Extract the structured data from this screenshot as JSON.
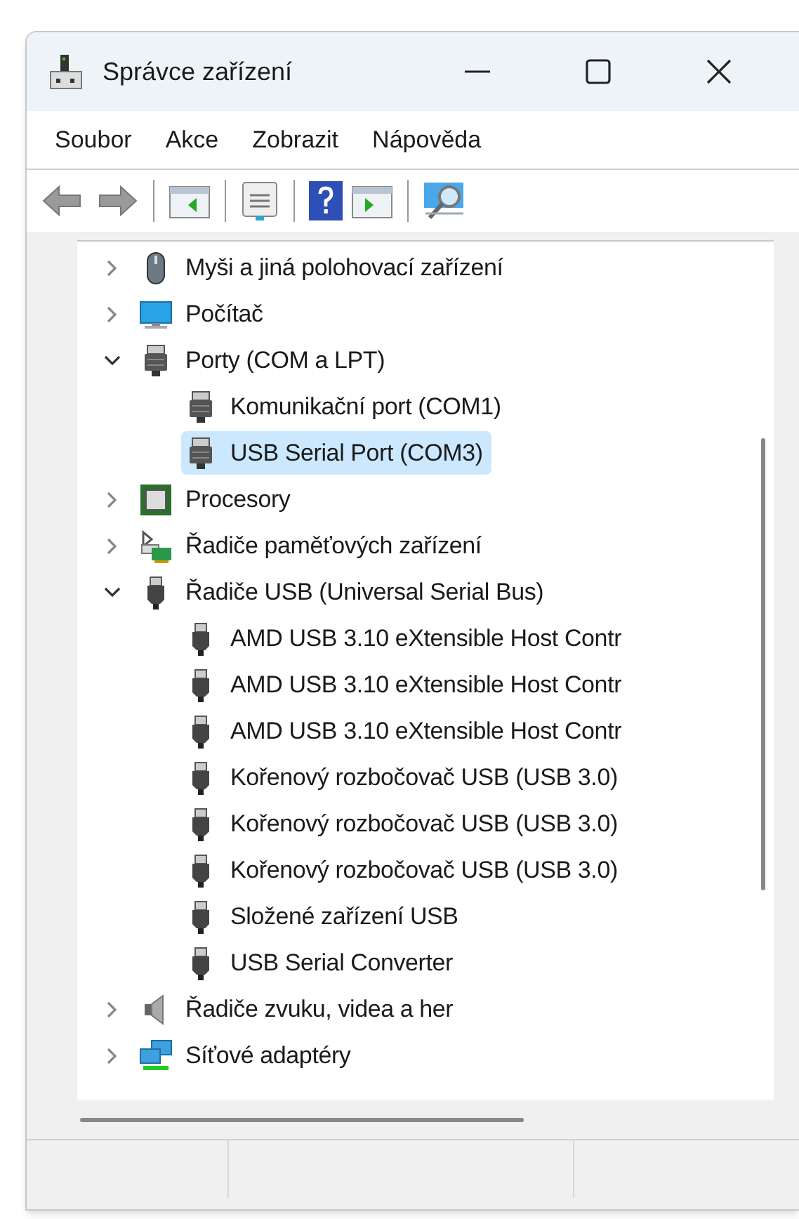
{
  "window": {
    "title": "Správce zařízení"
  },
  "menu": [
    "Soubor",
    "Akce",
    "Zobrazit",
    "Nápověda"
  ],
  "tree": [
    {
      "kind": "mouse",
      "label": "Myši a jiná polohovací zařízení",
      "expanded": false,
      "selected": false
    },
    {
      "kind": "computer",
      "label": "Počítač",
      "expanded": false,
      "selected": false
    },
    {
      "kind": "port",
      "label": "Porty (COM a LPT)",
      "expanded": true,
      "selected": false,
      "children": [
        {
          "kind": "port",
          "label": "Komunikační port (COM1)",
          "selected": false
        },
        {
          "kind": "port",
          "label": "USB Serial Port (COM3)",
          "selected": true
        }
      ]
    },
    {
      "kind": "cpu",
      "label": "Procesory",
      "expanded": false,
      "selected": false
    },
    {
      "kind": "storage",
      "label": "Řadiče paměťových zařízení",
      "expanded": false,
      "selected": false
    },
    {
      "kind": "usb",
      "label": "Řadiče USB (Universal Serial Bus)",
      "expanded": true,
      "selected": false,
      "children": [
        {
          "kind": "usb",
          "label": "AMD USB 3.10 eXtensible Host Contr",
          "selected": false
        },
        {
          "kind": "usb",
          "label": "AMD USB 3.10 eXtensible Host Contr",
          "selected": false
        },
        {
          "kind": "usb",
          "label": "AMD USB 3.10 eXtensible Host Contr",
          "selected": false
        },
        {
          "kind": "usb",
          "label": "Kořenový rozbočovač USB (USB 3.0)",
          "selected": false
        },
        {
          "kind": "usb",
          "label": "Kořenový rozbočovač USB (USB 3.0)",
          "selected": false
        },
        {
          "kind": "usb",
          "label": "Kořenový rozbočovač USB (USB 3.0)",
          "selected": false
        },
        {
          "kind": "usb",
          "label": "Složené zařízení USB",
          "selected": false
        },
        {
          "kind": "usb",
          "label": "USB Serial Converter",
          "selected": false
        }
      ]
    },
    {
      "kind": "sound",
      "label": "Řadiče zvuku, videa a her",
      "expanded": false,
      "selected": false
    },
    {
      "kind": "network",
      "label": "Síťové adaptéry",
      "expanded": false,
      "selected": false
    }
  ]
}
